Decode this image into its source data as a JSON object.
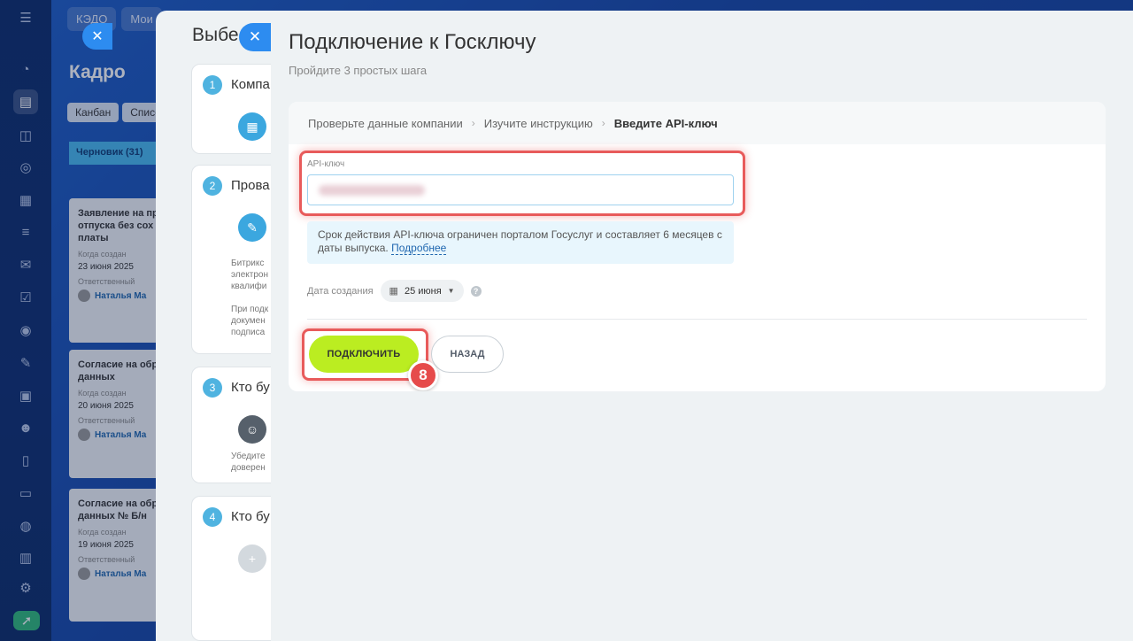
{
  "background": {
    "top_chips": [
      "КЭДО",
      "Мои"
    ],
    "title": "Кадро",
    "tabs": [
      "Канбан",
      "Списо"
    ],
    "column_header": "Черновик (31)",
    "cards": [
      {
        "title": "Заявление на пр отпуска без сох платы",
        "created_label": "Когда создан",
        "created": "23 июня 2025",
        "resp_label": "Ответственный",
        "resp": "Наталья Ма"
      },
      {
        "title": "Согласие на обр данных",
        "created_label": "Когда создан",
        "created": "20 июня 2025",
        "resp_label": "Ответственный",
        "resp": "Наталья Ма"
      },
      {
        "title": "Согласие на обр данных № Б/н",
        "created_label": "Когда создан",
        "created": "19 июня 2025",
        "resp_label": "Ответственный",
        "resp": "Наталья Ма"
      }
    ]
  },
  "middle_panel": {
    "title": "Выбе",
    "steps": [
      {
        "num": "1",
        "title": "Компа"
      },
      {
        "num": "2",
        "title": "Прова",
        "lines": [
          "Битрикс",
          "электрон",
          "квалифи",
          "При подк",
          "докумен",
          "подписа"
        ]
      },
      {
        "num": "3",
        "title": "Кто бу",
        "lines": [
          "Убедите",
          "доверен"
        ]
      },
      {
        "num": "4",
        "title": "Кто бу"
      }
    ]
  },
  "panel": {
    "title": "Подключение к Госключу",
    "subtitle": "Пройдите 3 простых шага",
    "breadcrumbs": [
      "Проверьте данные компании",
      "Изучите инструкцию",
      "Введите API-ключ"
    ],
    "api_label": "API-ключ",
    "info_text": "Срок действия API-ключа ограничен порталом Госуслуг и составляет 6 месяцев с даты выпуска.",
    "info_link": "Подробнее",
    "date_label": "Дата создания",
    "date_value": "25 июня",
    "connect_label": "ПОДКЛЮЧИТЬ",
    "back_label": "НАЗАД",
    "step_badge": "8"
  },
  "colors": {
    "accent": "#2d8cf0",
    "connect": "#bbed21",
    "highlight": "#e85b5b"
  }
}
